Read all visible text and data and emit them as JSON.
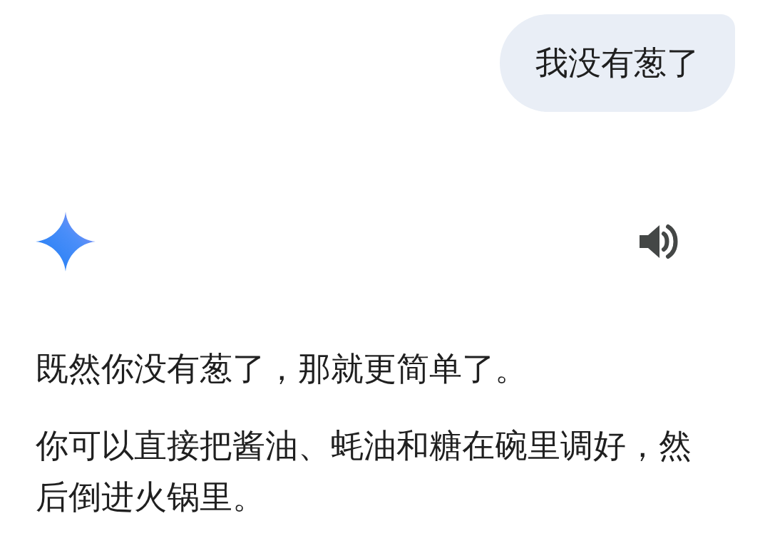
{
  "user_message": {
    "text": "我没有葱了"
  },
  "reply": {
    "paragraphs": [
      "既然你没有葱了，那就更简单了。",
      "你可以直接把酱油、蚝油和糖在碗里调好，然后倒进火锅里。"
    ]
  }
}
